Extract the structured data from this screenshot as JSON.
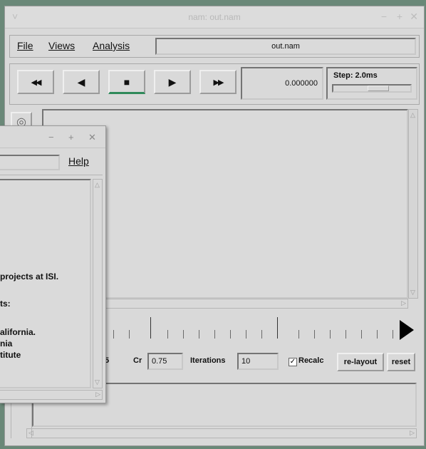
{
  "window": {
    "title": "nam: out.nam",
    "controls": [
      "−",
      "+",
      "✕"
    ]
  },
  "menu": {
    "file": "File",
    "views": "Views",
    "analysis": "Analysis",
    "filename": "out.nam"
  },
  "toolbar": {
    "rewind_icon": "◀◀",
    "back_icon": "◀",
    "stop_icon": "■",
    "play_icon": "▶",
    "ffwd_icon": "▶▶",
    "time": "0.000000",
    "step_label": "Step: 2.0ms"
  },
  "params": {
    "value_clipped": "5",
    "cr_label": "Cr",
    "cr_value": "0.75",
    "iterations_label": "Iterations",
    "iterations_value": "10",
    "recalc_label": "Recalc",
    "recalc_checked": true,
    "relayout_label": "re-layout",
    "reset_label": "reset"
  },
  "popup": {
    "controls": [
      "−",
      "+",
      "✕"
    ],
    "help": "Help",
    "lines": [
      "projects at ISI.",
      "ts:",
      "alifornia.",
      "nia",
      "titute"
    ]
  }
}
